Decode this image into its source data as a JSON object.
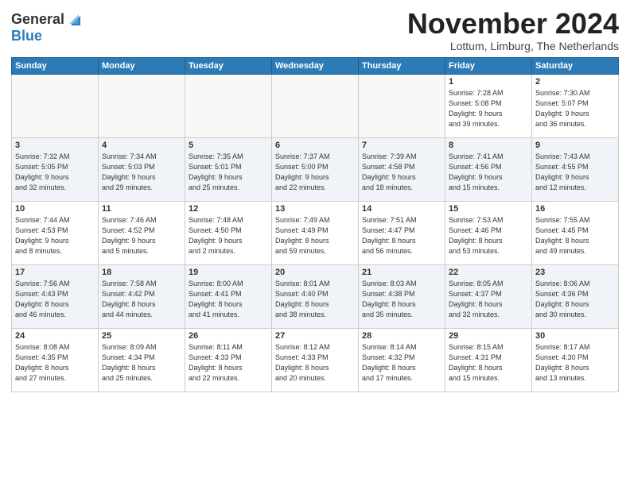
{
  "logo": {
    "general": "General",
    "blue": "Blue"
  },
  "header": {
    "month": "November 2024",
    "location": "Lottum, Limburg, The Netherlands"
  },
  "weekdays": [
    "Sunday",
    "Monday",
    "Tuesday",
    "Wednesday",
    "Thursday",
    "Friday",
    "Saturday"
  ],
  "weeks": [
    [
      {
        "day": "",
        "info": ""
      },
      {
        "day": "",
        "info": ""
      },
      {
        "day": "",
        "info": ""
      },
      {
        "day": "",
        "info": ""
      },
      {
        "day": "",
        "info": ""
      },
      {
        "day": "1",
        "info": "Sunrise: 7:28 AM\nSunset: 5:08 PM\nDaylight: 9 hours\nand 39 minutes."
      },
      {
        "day": "2",
        "info": "Sunrise: 7:30 AM\nSunset: 5:07 PM\nDaylight: 9 hours\nand 36 minutes."
      }
    ],
    [
      {
        "day": "3",
        "info": "Sunrise: 7:32 AM\nSunset: 5:05 PM\nDaylight: 9 hours\nand 32 minutes."
      },
      {
        "day": "4",
        "info": "Sunrise: 7:34 AM\nSunset: 5:03 PM\nDaylight: 9 hours\nand 29 minutes."
      },
      {
        "day": "5",
        "info": "Sunrise: 7:35 AM\nSunset: 5:01 PM\nDaylight: 9 hours\nand 25 minutes."
      },
      {
        "day": "6",
        "info": "Sunrise: 7:37 AM\nSunset: 5:00 PM\nDaylight: 9 hours\nand 22 minutes."
      },
      {
        "day": "7",
        "info": "Sunrise: 7:39 AM\nSunset: 4:58 PM\nDaylight: 9 hours\nand 18 minutes."
      },
      {
        "day": "8",
        "info": "Sunrise: 7:41 AM\nSunset: 4:56 PM\nDaylight: 9 hours\nand 15 minutes."
      },
      {
        "day": "9",
        "info": "Sunrise: 7:43 AM\nSunset: 4:55 PM\nDaylight: 9 hours\nand 12 minutes."
      }
    ],
    [
      {
        "day": "10",
        "info": "Sunrise: 7:44 AM\nSunset: 4:53 PM\nDaylight: 9 hours\nand 8 minutes."
      },
      {
        "day": "11",
        "info": "Sunrise: 7:46 AM\nSunset: 4:52 PM\nDaylight: 9 hours\nand 5 minutes."
      },
      {
        "day": "12",
        "info": "Sunrise: 7:48 AM\nSunset: 4:50 PM\nDaylight: 9 hours\nand 2 minutes."
      },
      {
        "day": "13",
        "info": "Sunrise: 7:49 AM\nSunset: 4:49 PM\nDaylight: 8 hours\nand 59 minutes."
      },
      {
        "day": "14",
        "info": "Sunrise: 7:51 AM\nSunset: 4:47 PM\nDaylight: 8 hours\nand 56 minutes."
      },
      {
        "day": "15",
        "info": "Sunrise: 7:53 AM\nSunset: 4:46 PM\nDaylight: 8 hours\nand 53 minutes."
      },
      {
        "day": "16",
        "info": "Sunrise: 7:55 AM\nSunset: 4:45 PM\nDaylight: 8 hours\nand 49 minutes."
      }
    ],
    [
      {
        "day": "17",
        "info": "Sunrise: 7:56 AM\nSunset: 4:43 PM\nDaylight: 8 hours\nand 46 minutes."
      },
      {
        "day": "18",
        "info": "Sunrise: 7:58 AM\nSunset: 4:42 PM\nDaylight: 8 hours\nand 44 minutes."
      },
      {
        "day": "19",
        "info": "Sunrise: 8:00 AM\nSunset: 4:41 PM\nDaylight: 8 hours\nand 41 minutes."
      },
      {
        "day": "20",
        "info": "Sunrise: 8:01 AM\nSunset: 4:40 PM\nDaylight: 8 hours\nand 38 minutes."
      },
      {
        "day": "21",
        "info": "Sunrise: 8:03 AM\nSunset: 4:38 PM\nDaylight: 8 hours\nand 35 minutes."
      },
      {
        "day": "22",
        "info": "Sunrise: 8:05 AM\nSunset: 4:37 PM\nDaylight: 8 hours\nand 32 minutes."
      },
      {
        "day": "23",
        "info": "Sunrise: 8:06 AM\nSunset: 4:36 PM\nDaylight: 8 hours\nand 30 minutes."
      }
    ],
    [
      {
        "day": "24",
        "info": "Sunrise: 8:08 AM\nSunset: 4:35 PM\nDaylight: 8 hours\nand 27 minutes."
      },
      {
        "day": "25",
        "info": "Sunrise: 8:09 AM\nSunset: 4:34 PM\nDaylight: 8 hours\nand 25 minutes."
      },
      {
        "day": "26",
        "info": "Sunrise: 8:11 AM\nSunset: 4:33 PM\nDaylight: 8 hours\nand 22 minutes."
      },
      {
        "day": "27",
        "info": "Sunrise: 8:12 AM\nSunset: 4:33 PM\nDaylight: 8 hours\nand 20 minutes."
      },
      {
        "day": "28",
        "info": "Sunrise: 8:14 AM\nSunset: 4:32 PM\nDaylight: 8 hours\nand 17 minutes."
      },
      {
        "day": "29",
        "info": "Sunrise: 8:15 AM\nSunset: 4:31 PM\nDaylight: 8 hours\nand 15 minutes."
      },
      {
        "day": "30",
        "info": "Sunrise: 8:17 AM\nSunset: 4:30 PM\nDaylight: 8 hours\nand 13 minutes."
      }
    ]
  ]
}
